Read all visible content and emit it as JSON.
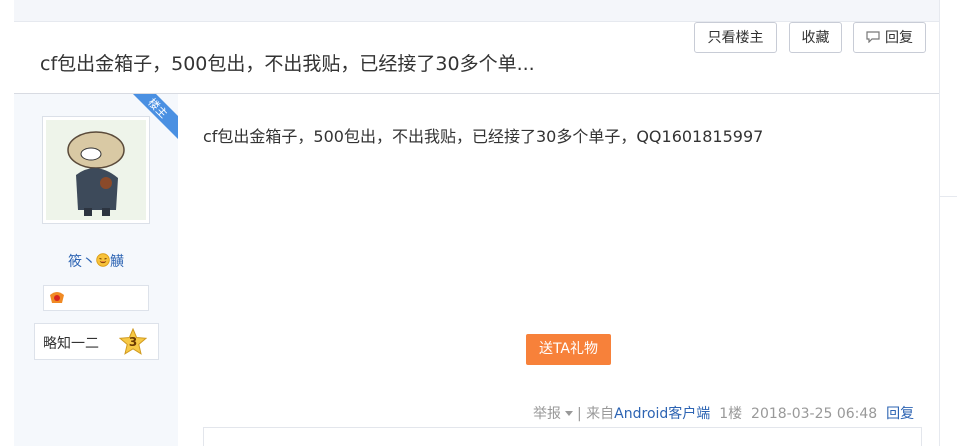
{
  "thread": {
    "title": "cf包出金箱子，500包出，不出我贴，已经接了30多个单...",
    "buttons": {
      "only_op": "只看楼主",
      "favorite": "收藏",
      "reply": "回复"
    }
  },
  "post": {
    "op_badge": "楼主",
    "username_prefix": "筱丶",
    "username_suffix": "觵",
    "level_title": "略知一二",
    "level": "3",
    "content": "cf包出金箱子，500包出，不出我贴，已经接了30多个单子，QQ1601815997",
    "gift_button": "送TA礼物",
    "meta": {
      "report": "举报",
      "separator": "|",
      "from_prefix": "来自",
      "client": "Android客户端",
      "floor": "1楼",
      "timestamp": "2018-03-25 06:48",
      "reply": "回复"
    }
  },
  "colors": {
    "link": "#2d64b3",
    "gift": "#f7813a",
    "op_badge": "#4a90e2"
  }
}
